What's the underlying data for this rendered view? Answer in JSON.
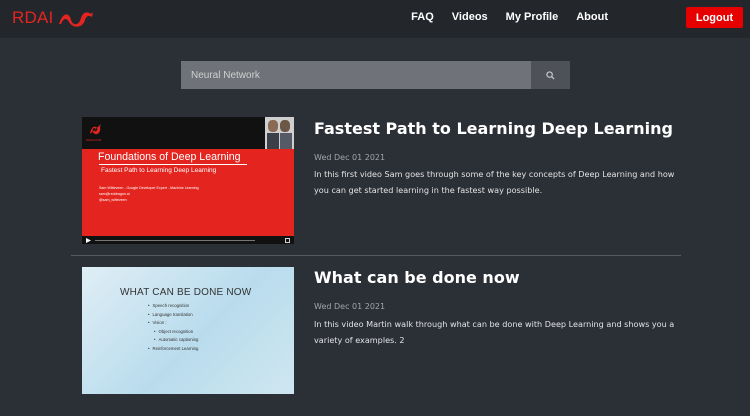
{
  "brand": {
    "name": "RDAI",
    "logo_icon": "red-dragon-icon",
    "color": "#e52421"
  },
  "nav": {
    "items": [
      "FAQ",
      "Videos",
      "My Profile",
      "About"
    ],
    "logout_label": "Logout",
    "logout_color": "#e60000"
  },
  "search": {
    "placeholder": "Neural Network",
    "icon": "search-icon"
  },
  "videos": [
    {
      "title": "Fastest Path to Learning Deep Learning",
      "date": "Wed Dec 01 2021",
      "description": "In this first video Sam goes through some of the key concepts of Deep Learning and how you can get started learning in the fastest way possible.",
      "thumbnail": {
        "logo_text": "RDRAGON",
        "heading": "Foundations of Deep Learning",
        "subheading": "Fastest Path to Learning Deep Learning",
        "lines": [
          "Sam Witteveen - Google Developer Expert - Machine Learning",
          "sam@reddragon.ai",
          "@sam_witteveen"
        ]
      }
    },
    {
      "title": "What can be done now",
      "date": "Wed Dec 01 2021",
      "description": "In this video Martin walk through what can be done with Deep Learning and shows you a variety of examples. 2",
      "thumbnail": {
        "heading": "WHAT CAN BE DONE NOW",
        "items": [
          "Speech recognition",
          "Language translation",
          "Vision :",
          "Object recognition",
          "Automatic captioning",
          "Reinforcement Learning"
        ]
      }
    }
  ]
}
